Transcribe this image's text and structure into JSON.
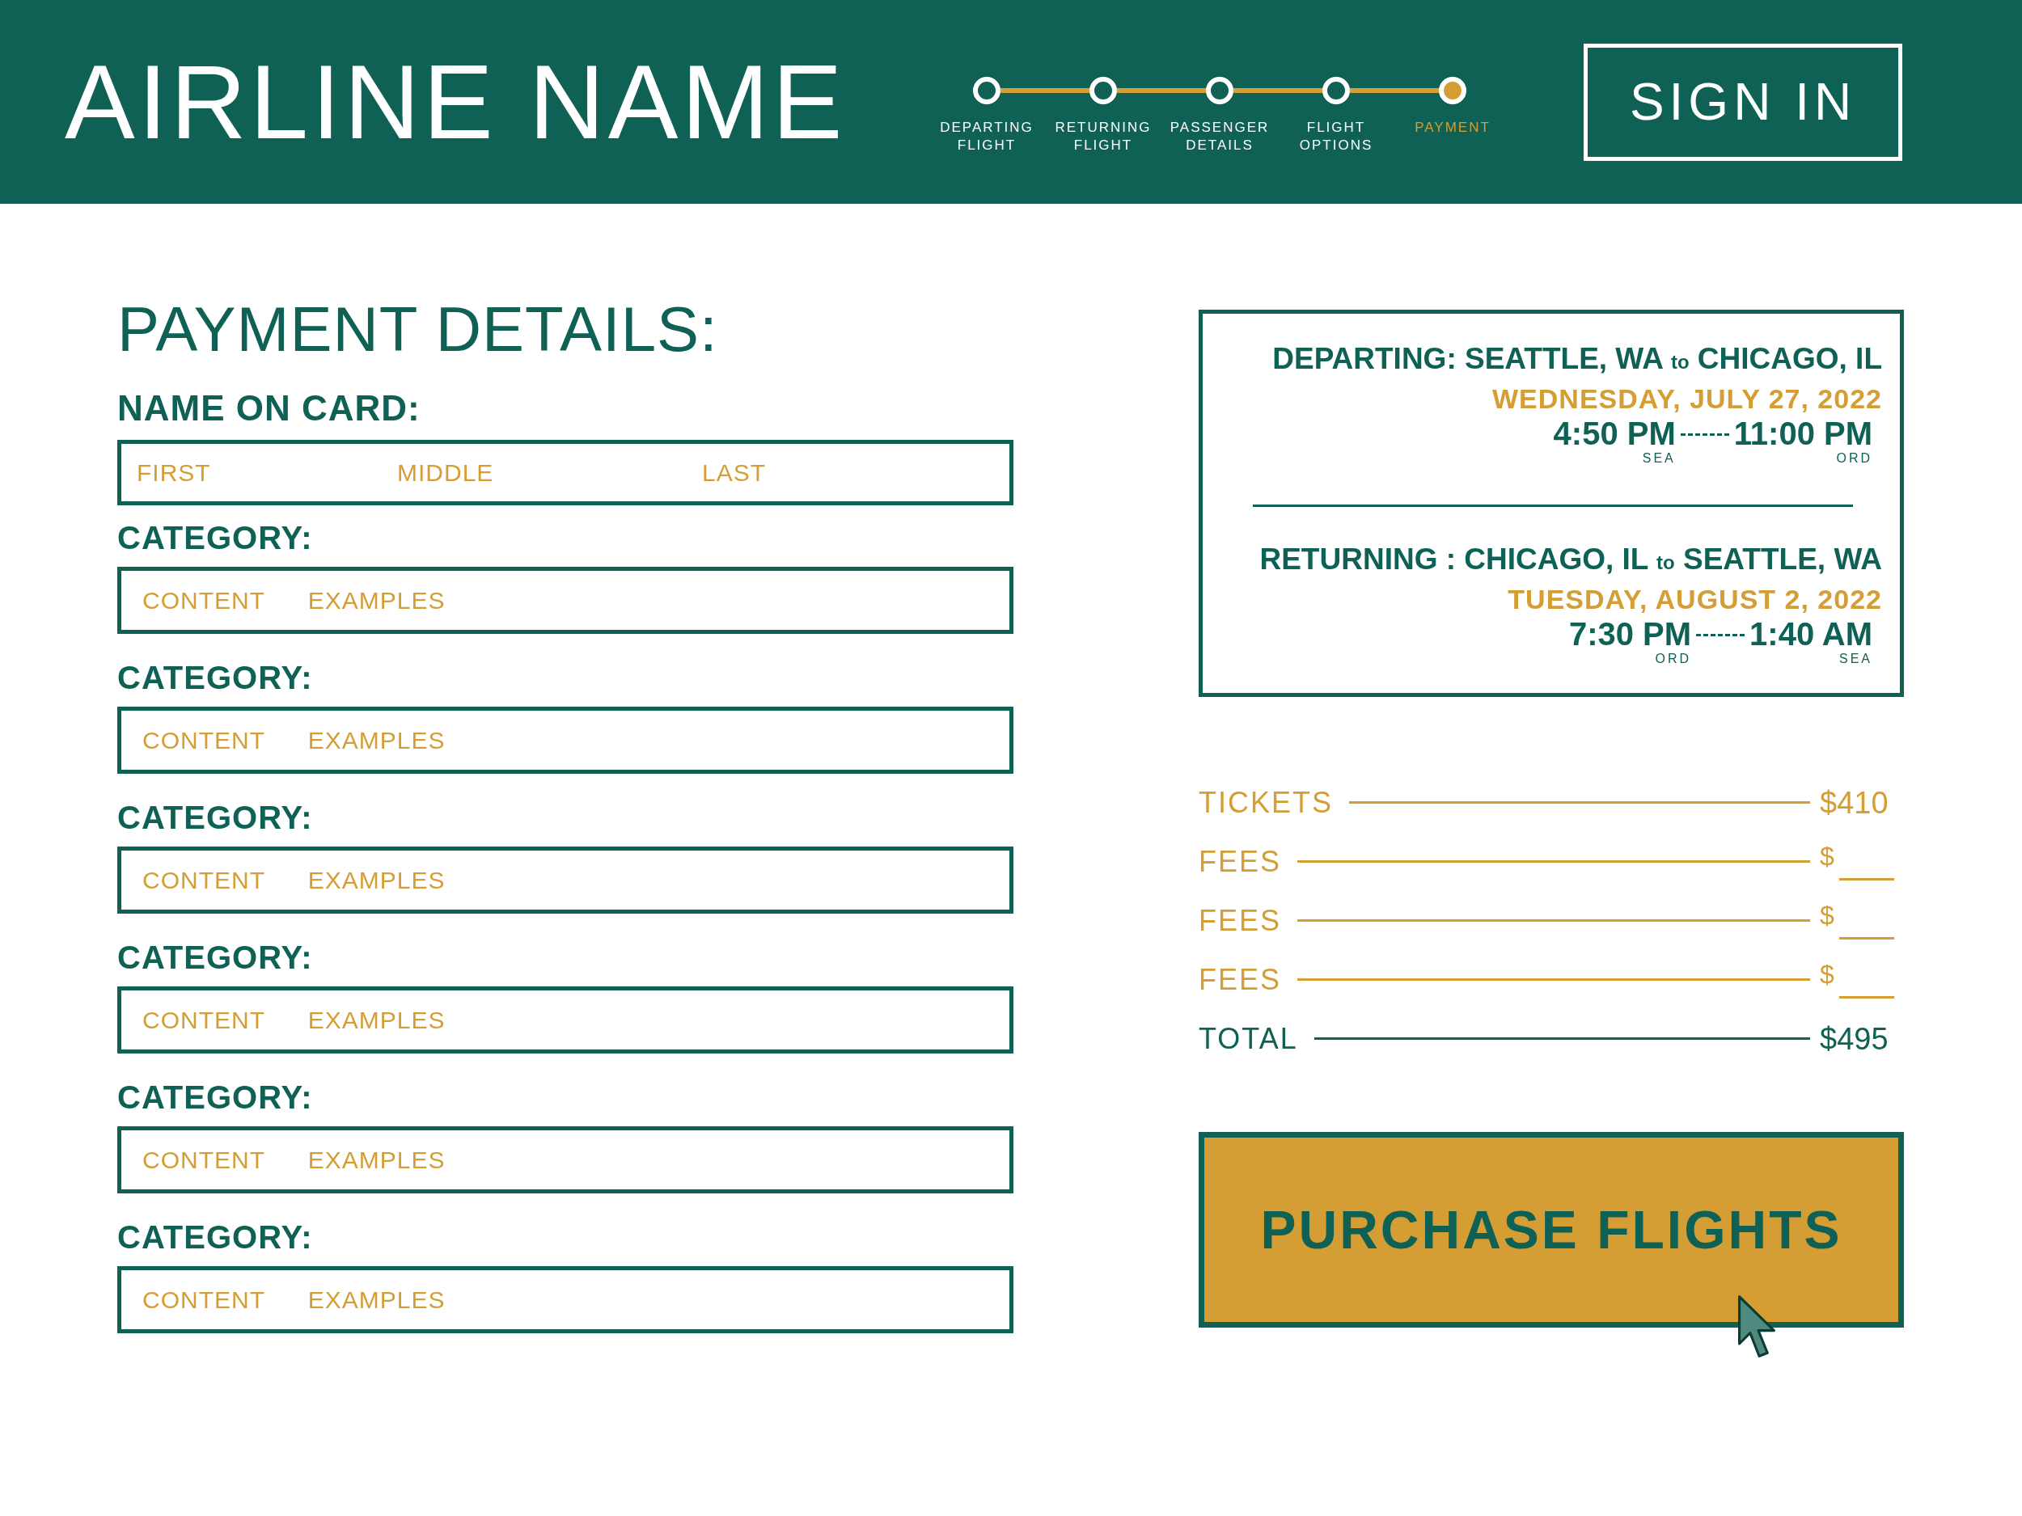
{
  "header": {
    "title": "AIRLINE NAME",
    "steps": [
      {
        "label": "DEPARTING FLIGHT",
        "selected": false
      },
      {
        "label": "RETURNING FLIGHT",
        "selected": false
      },
      {
        "label": "PASSENGER DETAILS",
        "selected": false
      },
      {
        "label": "FLIGHT OPTIONS",
        "selected": false
      },
      {
        "label": "PAYMENT",
        "selected": true
      }
    ],
    "sign_in": "SIGN IN"
  },
  "payment_form": {
    "title": "PAYMENT DETAILS:",
    "name_on_card": {
      "label": "NAME ON CARD:",
      "fields": [
        {
          "placeholder": "FIRST"
        },
        {
          "placeholder": "MIDDLE"
        },
        {
          "placeholder": "LAST"
        }
      ]
    },
    "fields": [
      {
        "label": "CATEGORY:",
        "placeholder": "CONTENT EXAMPLES"
      },
      {
        "label": "CATEGORY:",
        "placeholder": "CONTENT EXAMPLES"
      },
      {
        "label": "CATEGORY:",
        "placeholder": "CONTENT EXAMPLES"
      },
      {
        "label": "CATEGORY:",
        "placeholder": "CONTENT EXAMPLES"
      },
      {
        "label": "CATEGORY:",
        "placeholder": "CONTENT EXAMPLES"
      },
      {
        "label": "CATEGORY:",
        "placeholder": "CONTENT EXAMPLES"
      }
    ]
  },
  "trip_summary": {
    "flights": [
      {
        "label": "DEPARTING:",
        "from": "SEATTLE, WA",
        "connector": "to",
        "to": "CHICAGO, IL",
        "date": "WEDNESDAY, JULY 27, 2022",
        "departure_time": "4:50 PM",
        "departure_airport": "SEA",
        "arrival_time": "11:00 PM",
        "arrival_airport": "ORD"
      },
      {
        "label": "RETURNING :",
        "from": "CHICAGO, IL",
        "connector": "to",
        "to": "SEATTLE, WA",
        "date": "TUESDAY, AUGUST 2, 2022",
        "departure_time": "7:30 PM",
        "departure_airport": "ORD",
        "arrival_time": "1:40 AM",
        "arrival_airport": "SEA"
      }
    ]
  },
  "price_breakdown": [
    {
      "kind": "amount",
      "label": "TICKETS",
      "value": "$410"
    },
    {
      "kind": "blank",
      "label": "FEES",
      "value": "$"
    },
    {
      "kind": "blank",
      "label": "FEES",
      "value": "$"
    },
    {
      "kind": "blank",
      "label": "FEES",
      "value": "$"
    },
    {
      "kind": "total",
      "label": "TOTAL",
      "value": "$495"
    }
  ],
  "purchase_button": "PURCHASE FLIGHTS"
}
